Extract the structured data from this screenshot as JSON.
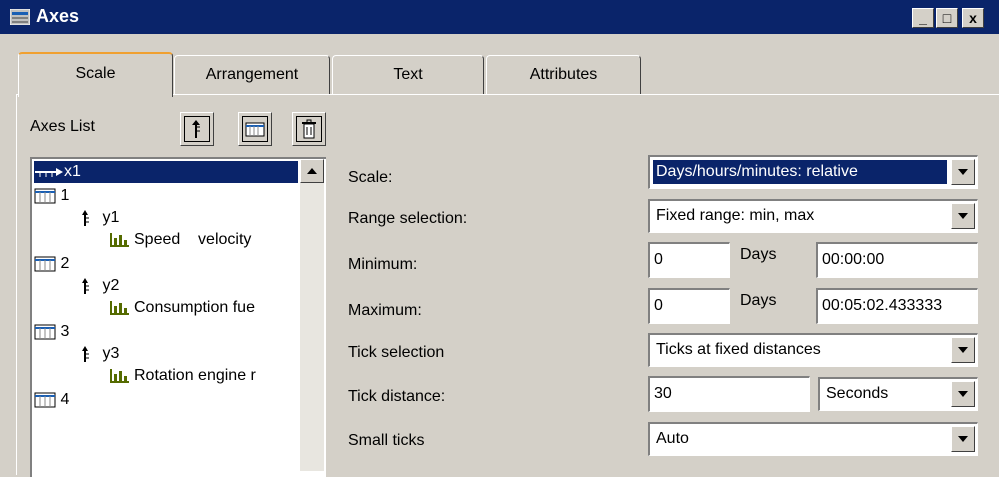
{
  "window": {
    "title": "Axes",
    "controls": [
      "_",
      "□",
      "x"
    ]
  },
  "tabs": [
    {
      "label": "Scale",
      "active": true
    },
    {
      "label": "Arrangement",
      "active": false
    },
    {
      "label": "Text",
      "active": false
    },
    {
      "label": "Attributes",
      "active": false
    }
  ],
  "axes_list": {
    "label": "Axes List",
    "items": [
      {
        "text": "x1",
        "kind": "x-axis",
        "selected": true
      },
      {
        "text": "1",
        "kind": "system"
      },
      {
        "text": "y1",
        "kind": "y-axis"
      },
      {
        "text": "Speed    velocity",
        "kind": "channel"
      },
      {
        "text": "2",
        "kind": "system"
      },
      {
        "text": "y2",
        "kind": "y-axis"
      },
      {
        "text": "Consumption fue",
        "kind": "channel"
      },
      {
        "text": "3",
        "kind": "system"
      },
      {
        "text": "y3",
        "kind": "y-axis"
      },
      {
        "text": "Rotation engine r",
        "kind": "channel"
      },
      {
        "text": "4",
        "kind": "system"
      }
    ]
  },
  "form": {
    "scale_label": "Scale:",
    "scale_value": "Days/hours/minutes: relative",
    "range_label": "Range selection:",
    "range_value": "Fixed range: min, max",
    "minimum_label": "Minimum:",
    "minimum_days": "0",
    "minimum_days_unit": "Days",
    "minimum_time": "00:00:00",
    "maximum_label": "Maximum:",
    "maximum_days": "0",
    "maximum_days_unit": "Days",
    "maximum_time": "00:05:02.433333",
    "tick_selection_label": "Tick selection",
    "tick_selection_value": "Ticks at fixed distances",
    "tick_distance_label": "Tick distance:",
    "tick_distance_value": "30",
    "tick_distance_unit": "Seconds",
    "small_ticks_label": "Small ticks",
    "small_ticks_value": "Auto"
  }
}
